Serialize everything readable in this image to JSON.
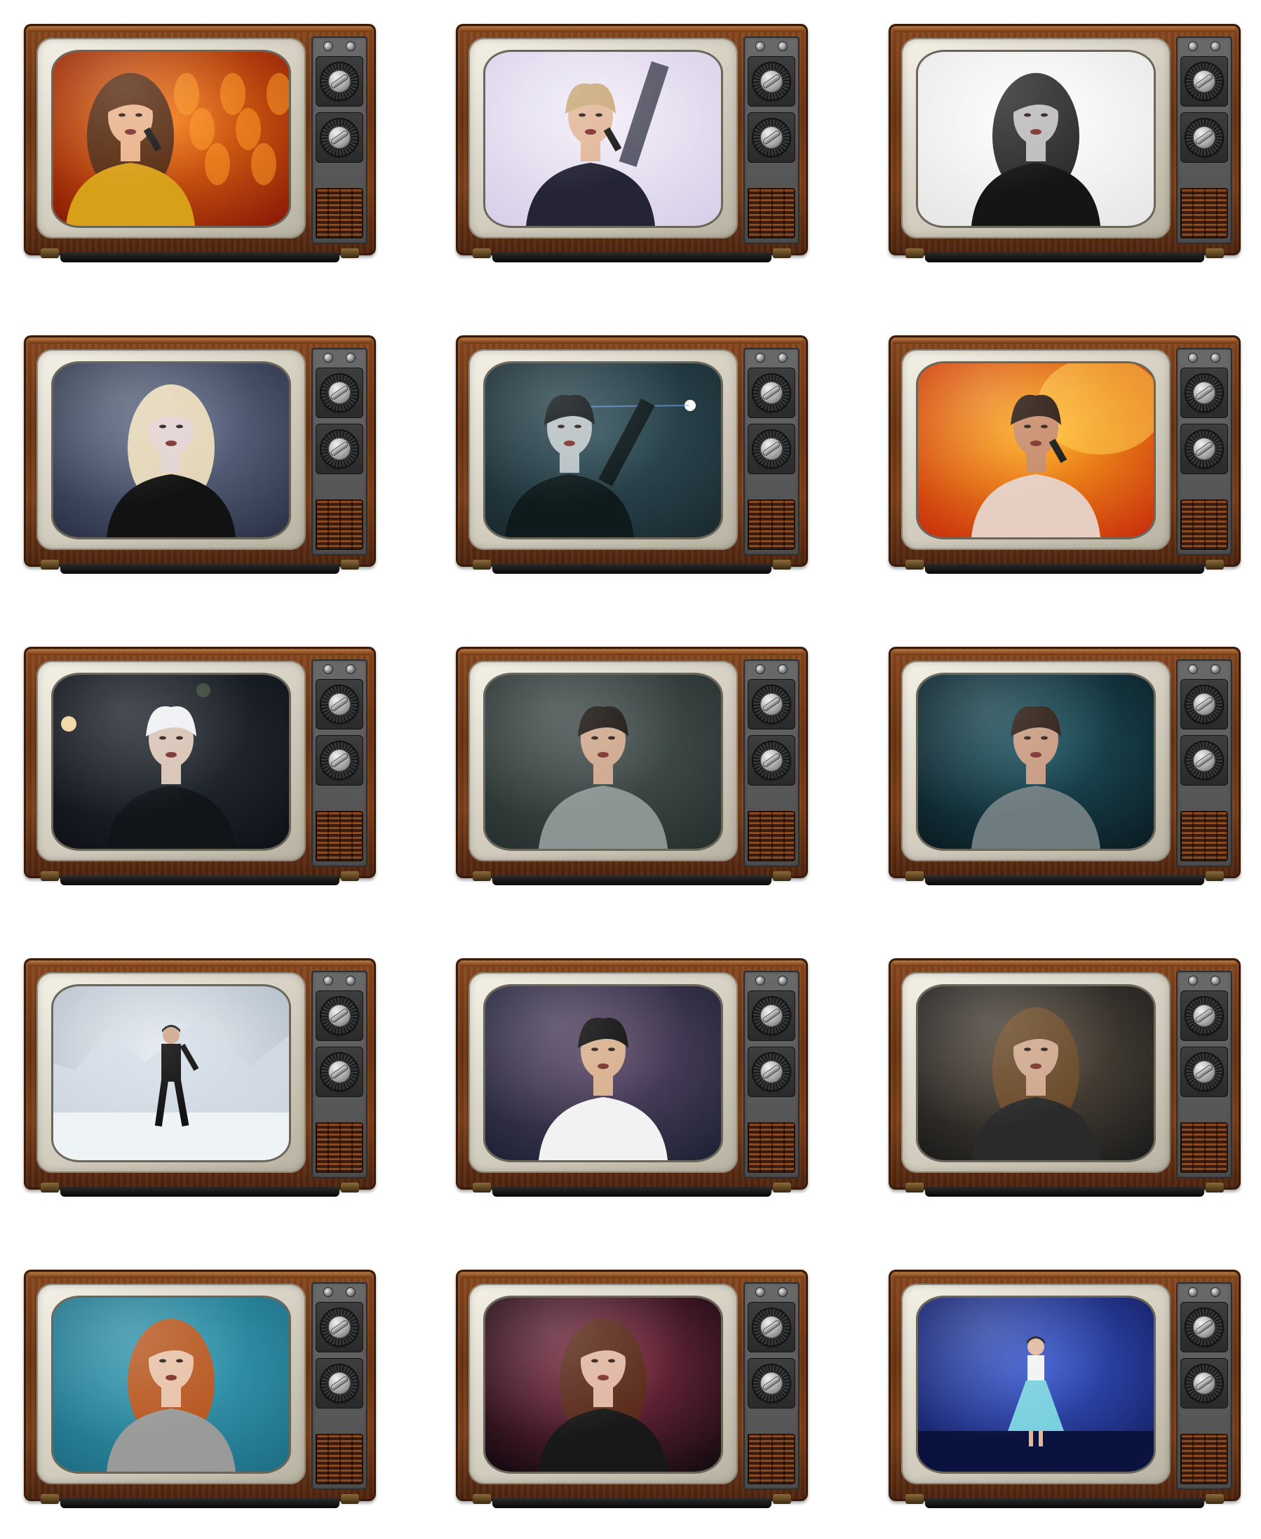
{
  "tvs": [
    {
      "id": "tv-1",
      "scene": "performer-fire-stage",
      "colors": {
        "bg1": "#8a1a06",
        "bg2": "#f27b18",
        "skin": "#e9b48c",
        "hair": "#5a2e14",
        "cloth": "#d8a018"
      }
    },
    {
      "id": "tv-2",
      "scene": "performer-arm-raised",
      "colors": {
        "bg1": "#d7cfe8",
        "bg2": "#f3eef8",
        "skin": "#e2b79a",
        "hair": "#c9a97a",
        "cloth": "#242434"
      }
    },
    {
      "id": "tv-3",
      "scene": "monochrome-portrait",
      "colors": {
        "bg1": "#e6e6e6",
        "bg2": "#ffffff",
        "skin": "#bdbdbd",
        "hair": "#2e2e2e",
        "cloth": "#151515"
      }
    },
    {
      "id": "tv-4",
      "scene": "blonde-portrait",
      "colors": {
        "bg1": "#2b3246",
        "bg2": "#6a7590",
        "skin": "#e3d4d2",
        "hair": "#e4d6b8",
        "cloth": "#121212"
      }
    },
    {
      "id": "tv-5",
      "scene": "night-silhouette",
      "colors": {
        "bg1": "#1a2a30",
        "bg2": "#33525c",
        "skin": "#b8c2c4",
        "hair": "#0d1416",
        "cloth": "#0f1a1c"
      }
    },
    {
      "id": "tv-6",
      "scene": "singer-orange-backdrop",
      "colors": {
        "bg1": "#c8300c",
        "bg2": "#ffb020",
        "skin": "#c88c6a",
        "hair": "#2a1a12",
        "cloth": "#e6cfc2"
      }
    },
    {
      "id": "tv-7",
      "scene": "platinum-hair-night",
      "colors": {
        "bg1": "#0e1218",
        "bg2": "#2a3038",
        "skin": "#d9c4b6",
        "hair": "#eef0f2",
        "cloth": "#111418"
      }
    },
    {
      "id": "tv-8",
      "scene": "young-man-grey-room",
      "colors": {
        "bg1": "#26302e",
        "bg2": "#4a5654",
        "skin": "#cfa88e",
        "hair": "#1a1410",
        "cloth": "#8c9494"
      }
    },
    {
      "id": "tv-9",
      "scene": "man-teal-light",
      "colors": {
        "bg1": "#0b1c22",
        "bg2": "#1f5664",
        "skin": "#c89a80",
        "hair": "#2a1a12",
        "cloth": "#6e7c80"
      }
    },
    {
      "id": "tv-10",
      "scene": "dancer-white-set",
      "colors": {
        "bg1": "#aeb9c6",
        "bg2": "#e7edf2",
        "skin": "#d1a68c",
        "hair": "#1a1a1a",
        "cloth": "#111111"
      }
    },
    {
      "id": "tv-11",
      "scene": "singer-white-halter",
      "colors": {
        "bg1": "#1e2236",
        "bg2": "#5e4a6a",
        "skin": "#d8b08e",
        "hair": "#0b0b0b",
        "cloth": "#f2f2f2"
      }
    },
    {
      "id": "tv-12",
      "scene": "long-hair-closeup",
      "colors": {
        "bg1": "#1c1c1c",
        "bg2": "#5a4e40",
        "skin": "#cfa88e",
        "hair": "#6a4a2a",
        "cloth": "#2a2a2a"
      }
    },
    {
      "id": "tv-13",
      "scene": "curly-red-hair",
      "colors": {
        "bg1": "#1e6e84",
        "bg2": "#3aa0b8",
        "skin": "#e8c2a8",
        "hair": "#b85a24",
        "cloth": "#9a9a9a"
      }
    },
    {
      "id": "tv-14",
      "scene": "woman-dark-pink-light",
      "colors": {
        "bg1": "#140a10",
        "bg2": "#8a3048",
        "skin": "#e0b6a2",
        "hair": "#5a2a1a",
        "cloth": "#181818"
      }
    },
    {
      "id": "tv-15",
      "scene": "blue-stage-dress",
      "colors": {
        "bg1": "#121a5a",
        "bg2": "#3a5ad0",
        "skin": "#dfb8a0",
        "hair": "#1a1010",
        "cloth": "#7ad0e0"
      }
    }
  ]
}
